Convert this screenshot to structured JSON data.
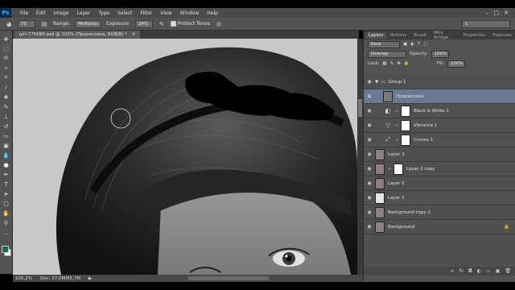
{
  "app": {
    "logo": "Ps",
    "menu": [
      "File",
      "Edit",
      "Image",
      "Layer",
      "Type",
      "Select",
      "Filter",
      "View",
      "Window",
      "Help"
    ],
    "window_controls": [
      "–",
      "□",
      "✕"
    ]
  },
  "options": {
    "brush_size": "70",
    "range_label": "Range:",
    "range_value": "Midtones",
    "exposure_label": "Exposure:",
    "exposure_value": "24%",
    "protect_tones_label": "Protect Tones",
    "workspace": "1"
  },
  "document": {
    "tab_title": "girl-775060.psd @ 105% (Прорисовка, RGB/8) *",
    "zoom": "105,2%",
    "doc_size": "Doc: 17,0M/85,7M"
  },
  "panels": {
    "tabs": [
      "Layers",
      "Actions",
      "Brush",
      "Mini Bridge",
      "Properties",
      "Features"
    ],
    "kind_label": "Kind",
    "blend_mode": "Overlay",
    "opacity_label": "Opacity:",
    "opacity_value": "100%",
    "lock_label": "Lock:",
    "fill_label": "Fill:",
    "fill_value": "100%"
  },
  "layers": [
    {
      "name": "Group 1",
      "type": "group"
    },
    {
      "name": "Прорисовка",
      "type": "pixel",
      "selected": true
    },
    {
      "name": "Black & White 1",
      "type": "adjustment",
      "icon": "bw-icon"
    },
    {
      "name": "Vibrance 1",
      "type": "adjustment",
      "icon": "vibrance-icon"
    },
    {
      "name": "Curves 1",
      "type": "adjustment",
      "icon": "curves-icon"
    },
    {
      "name": "Layer 3",
      "type": "pixel"
    },
    {
      "name": "Layer 2 copy",
      "type": "masked"
    },
    {
      "name": "Layer 2",
      "type": "pixel"
    },
    {
      "name": "Layer 1",
      "type": "transparent"
    },
    {
      "name": "Background copy 2",
      "type": "pixel"
    },
    {
      "name": "Background",
      "type": "background"
    }
  ],
  "colors": {
    "foreground": "#1a6b50",
    "background": "#ffffff",
    "selected_layer": "#697992"
  }
}
